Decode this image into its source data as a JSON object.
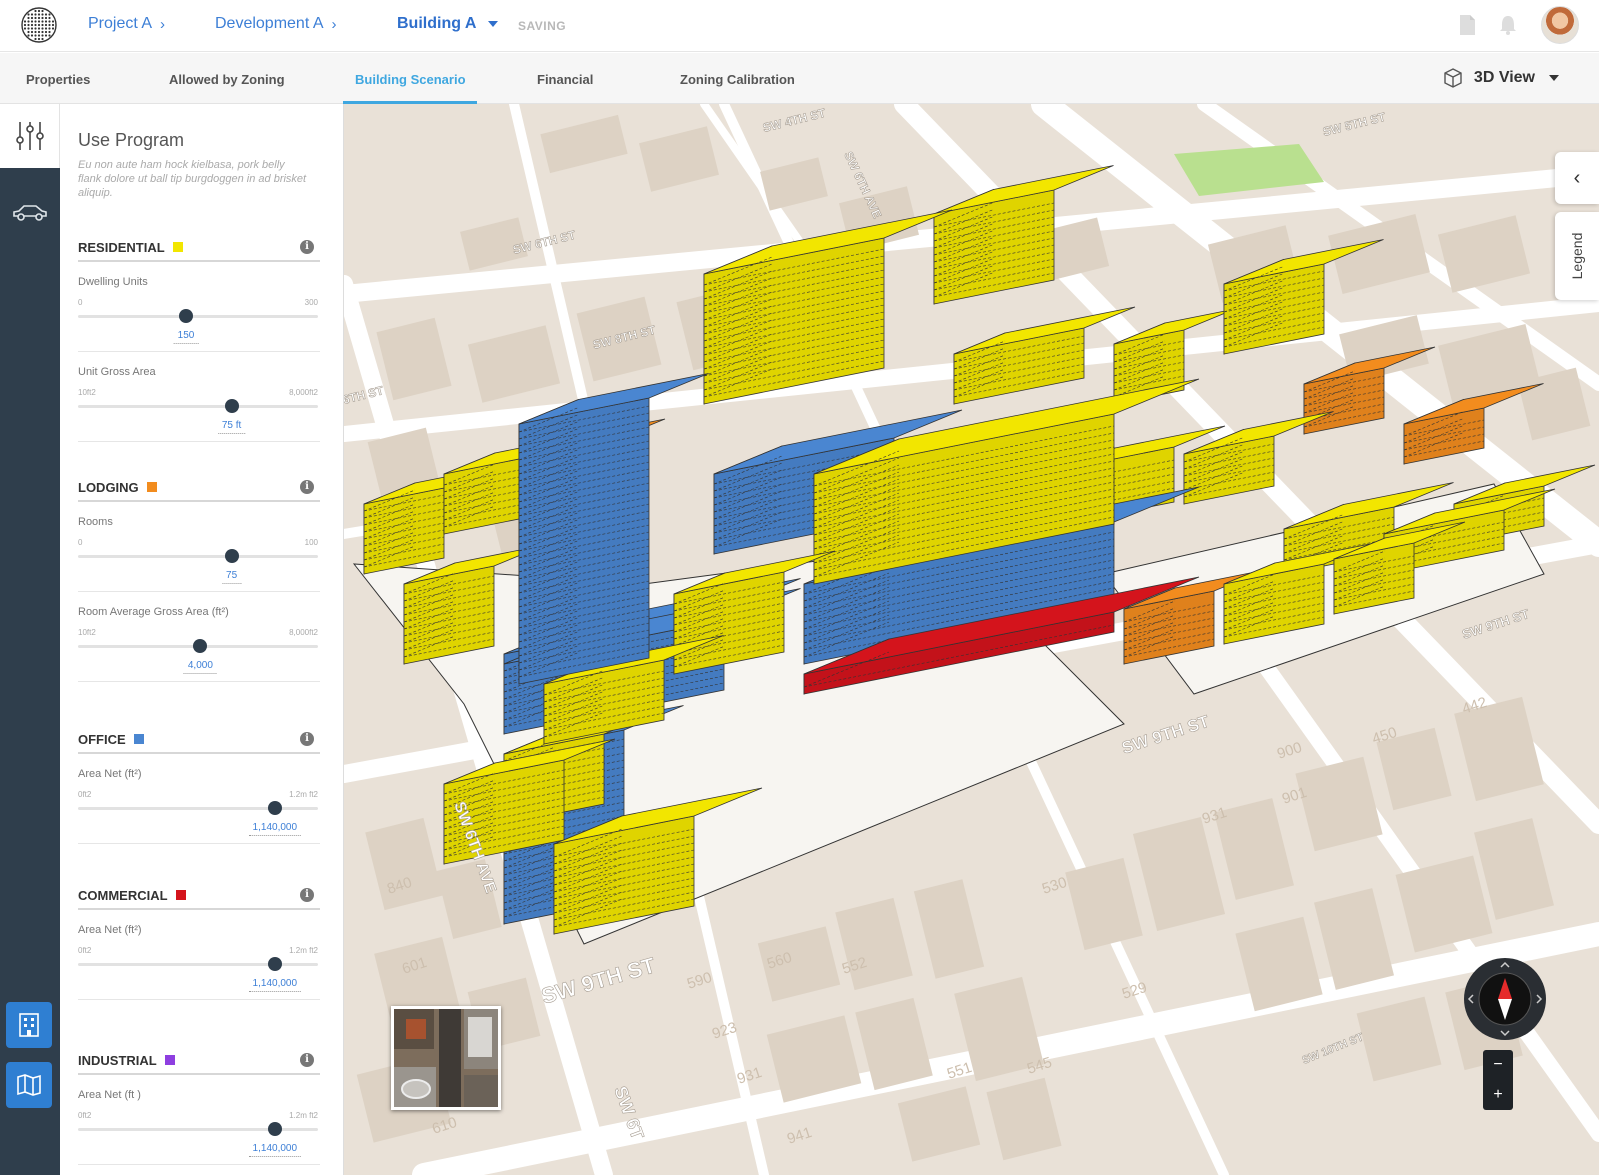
{
  "header": {
    "breadcrumbs": [
      "Project A",
      "Development A",
      "Building A"
    ],
    "status": "SAVING"
  },
  "tabs": [
    "Properties",
    "Allowed by Zoning",
    "Building Scenario",
    "Financial",
    "Zoning Calibration"
  ],
  "active_tab": "Building Scenario",
  "view_selector": "3D View",
  "panel": {
    "title": "Use Program",
    "description": "Eu non aute ham hock kielbasa, pork belly flank dolore ut ball tip burgdoggen in ad brisket aliquip.",
    "sections": [
      {
        "name": "RESIDENTIAL",
        "color": "#f2e600",
        "sliders": [
          {
            "label": "Dwelling Units",
            "min": "0",
            "max": "300",
            "value": "150",
            "fraction": 0.45
          },
          {
            "label": "Unit Gross Area",
            "min": "10ft2",
            "max": "8,000ft2",
            "value": "75  ft",
            "fraction": 0.64
          }
        ]
      },
      {
        "name": "LODGING",
        "color": "#f28c1e",
        "sliders": [
          {
            "label": "Rooms",
            "min": "0",
            "max": "100",
            "value": "75",
            "fraction": 0.64
          },
          {
            "label": "Room Average Gross Area (ft²)",
            "min": "10ft2",
            "max": "8,000ft2",
            "value": "4,000",
            "fraction": 0.51
          }
        ]
      },
      {
        "name": "OFFICE",
        "color": "#4a86d1",
        "sliders": [
          {
            "label": "Area Net (ft²)",
            "min": "0ft2",
            "max": "1.2m ft2",
            "value": "1,140,000",
            "fraction": 0.82
          }
        ]
      },
      {
        "name": "COMMERCIAL",
        "color": "#d4141c",
        "sliders": [
          {
            "label": "Area Net (ft²)",
            "min": "0ft2",
            "max": "1.2m ft2",
            "value": "1,140,000",
            "fraction": 0.82
          }
        ]
      },
      {
        "name": "INDUSTRIAL",
        "color": "#8e3fe0",
        "sliders": [
          {
            "label": "Area Net (ft )",
            "min": "0ft2",
            "max": "1.2m ft2",
            "value": "1,140,000",
            "fraction": 0.82
          }
        ]
      }
    ]
  },
  "map": {
    "streets": [
      "SW 9TH ST",
      "SW 9TH ST",
      "SW 6TH AVE",
      "SW 5TH ST",
      "SW 6TH ST",
      "SW 4TH ST",
      "SW 6TH AVE",
      "SW 10TH ST",
      "SW 8TH ST",
      "SW 9TH ST",
      "6TH ST",
      "SW 6T"
    ],
    "lot_numbers": [
      "840",
      "601",
      "590",
      "560",
      "552",
      "530",
      "529",
      "923",
      "931",
      "551",
      "545",
      "610",
      "941",
      "900",
      "931",
      "901",
      "450",
      "442"
    ],
    "legend_label": "Legend",
    "colors": {
      "residential": "#f2e600",
      "lodging": "#f28c1e",
      "office": "#4a86d1",
      "commercial": "#d4141c",
      "ground": "#e9e1d7",
      "road": "#ffffff",
      "park": "#b9e08f"
    }
  }
}
